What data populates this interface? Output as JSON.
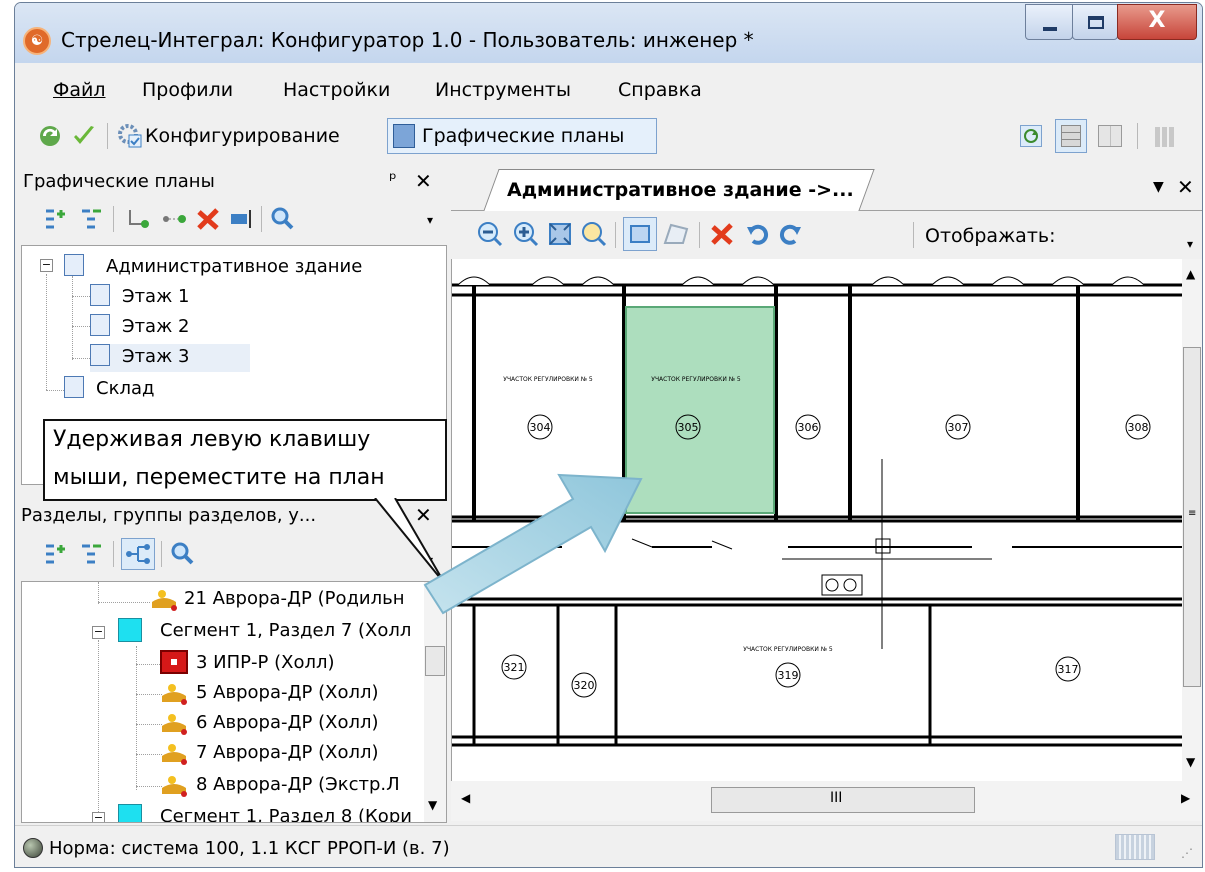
{
  "window": {
    "title": "Стрелец-Интеграл: Конфигуратор 1.0 - Пользователь: инженер *",
    "icon": "strelec-logo-icon"
  },
  "menu": {
    "items": [
      "Файл",
      "Профили",
      "Настройки",
      "Инструменты",
      "Справка"
    ]
  },
  "toolbar": {
    "configuring_label": "Конфигурирование",
    "plans_label": "Графические планы"
  },
  "plans_pane": {
    "title": "Графические планы",
    "pin": "ᵖ",
    "close": "✕",
    "tree": [
      {
        "label": "Административное здание"
      },
      {
        "label": "Этаж 1"
      },
      {
        "label": "Этаж 2"
      },
      {
        "label": "Этаж 3"
      },
      {
        "label": "Склад"
      }
    ]
  },
  "sections_pane": {
    "title": "Разделы, группы разделов, у...",
    "tree": [
      {
        "label": "21 Аврора-ДР (Родильн"
      },
      {
        "label": "Сегмент 1, Раздел 7 (Холл"
      },
      {
        "label": "3 ИПР-Р (Холл)"
      },
      {
        "label": "5 Аврора-ДР (Холл)"
      },
      {
        "label": "6 Аврора-ДР (Холл)"
      },
      {
        "label": "7 Аврора-ДР (Холл)"
      },
      {
        "label": "8 Аврора-ДР (Экстр.Л"
      },
      {
        "label": "Сегмент 1, Раздел 8 (Кори"
      }
    ]
  },
  "callout": {
    "line1": "Удерживая левую клавишу",
    "line2": "мыши, переместите на план"
  },
  "doc_tab": {
    "title": "Административное здание ->...",
    "show_label": "Отображать:"
  },
  "plan": {
    "rooms": [
      "304",
      "305",
      "306",
      "307",
      "308",
      "321",
      "320",
      "319",
      "317"
    ],
    "room_caption": "УЧАСТОК РЕГУЛИРОВКИ № 5",
    "highlight_color": "#9fd8b3"
  },
  "hscroll_grip": "III",
  "status": {
    "text": "Норма:  система 100, 1.1 КСГ РРОП-И (в. 7)"
  },
  "colors": {
    "accent": "#3c7fc4",
    "title_bg": "#c4d6ee",
    "close_red": "#c7453a"
  }
}
